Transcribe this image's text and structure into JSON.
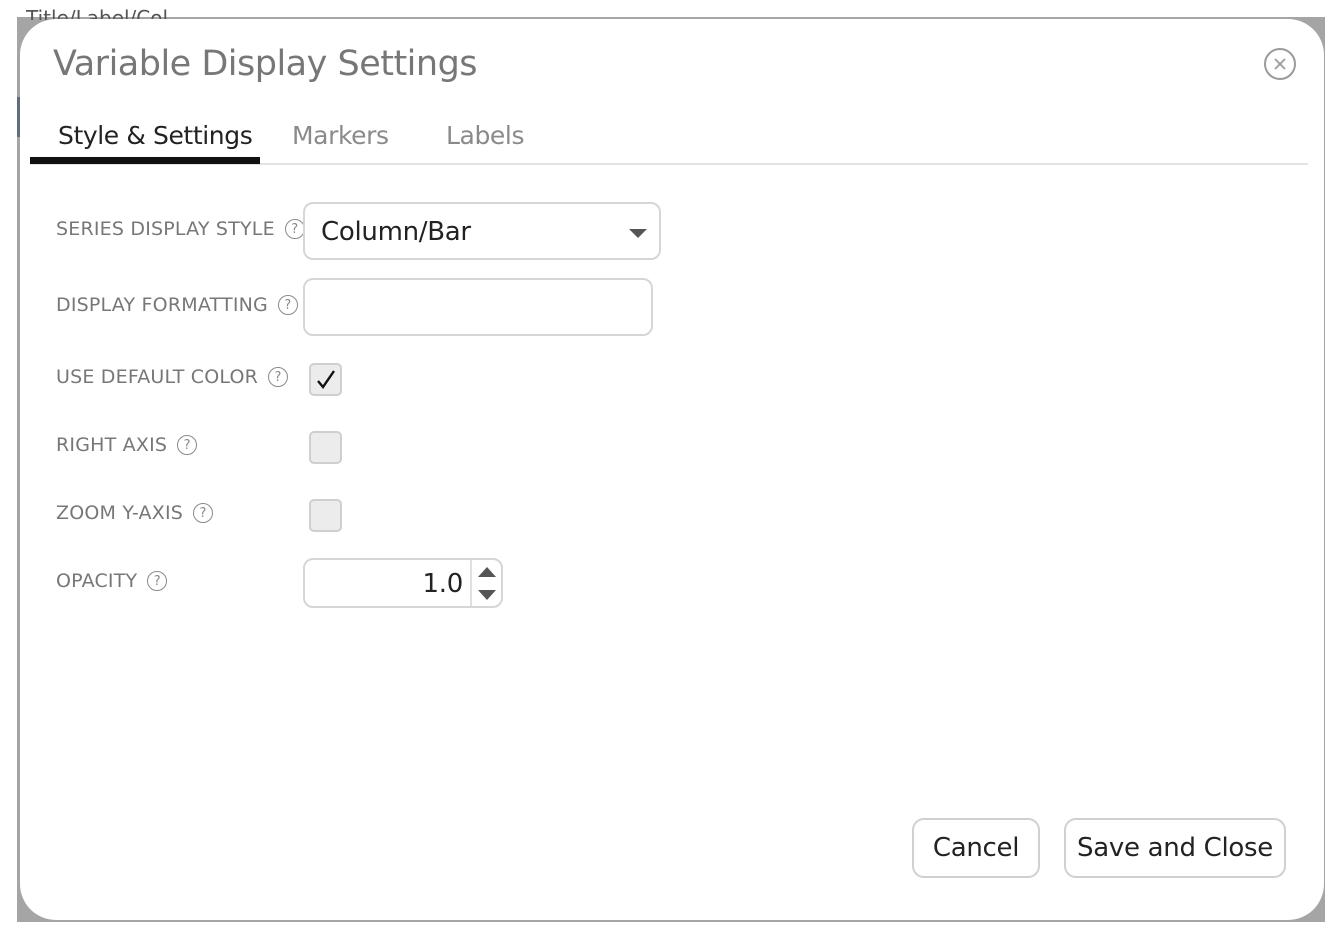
{
  "background": {
    "title_fragment": "Title/Label/Col"
  },
  "dialog": {
    "title": "Variable Display Settings",
    "close_icon": "close-circle-icon"
  },
  "tabs": [
    {
      "label": "Style & Settings",
      "active": true
    },
    {
      "label": "Markers",
      "active": false
    },
    {
      "label": "Labels",
      "active": false
    }
  ],
  "fields": {
    "series_display_style": {
      "label": "SERIES DISPLAY STYLE",
      "value": "Column/Bar"
    },
    "display_formatting": {
      "label": "DISPLAY FORMATTING",
      "value": ""
    },
    "use_default_color": {
      "label": "USE DEFAULT COLOR",
      "checked": true
    },
    "right_axis": {
      "label": "RIGHT AXIS",
      "checked": false
    },
    "zoom_y_axis": {
      "label": "ZOOM Y-AXIS",
      "checked": false
    },
    "opacity": {
      "label": "OPACITY",
      "value": "1.0"
    }
  },
  "help_icon_glyph": "?",
  "buttons": {
    "cancel": "Cancel",
    "save": "Save and Close"
  }
}
